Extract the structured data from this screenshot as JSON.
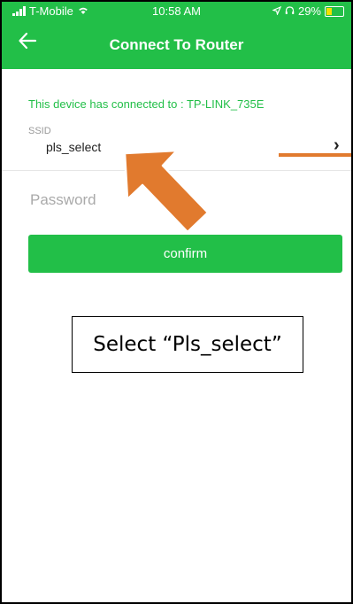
{
  "status_bar": {
    "carrier": "T-Mobile",
    "time": "10:58 AM",
    "battery": "29%",
    "icons": [
      "signal-icon",
      "wifi-icon",
      "location-icon",
      "headphones-icon",
      "battery-icon"
    ]
  },
  "nav": {
    "title": "Connect To Router",
    "back_icon": "back-arrow-icon"
  },
  "connection": {
    "message": "This device has connected to : TP-LINK_735E"
  },
  "ssid": {
    "label": "SSID",
    "value": "pls_select",
    "chevron": "›"
  },
  "password": {
    "placeholder": "Password",
    "value": ""
  },
  "confirm": {
    "label": "confirm"
  },
  "annotation": {
    "text": "Select “Pls_select”"
  },
  "colors": {
    "brand_green": "#22bf48",
    "arrow_orange": "#e17a2e",
    "battery_yellow": "#f5e000"
  }
}
